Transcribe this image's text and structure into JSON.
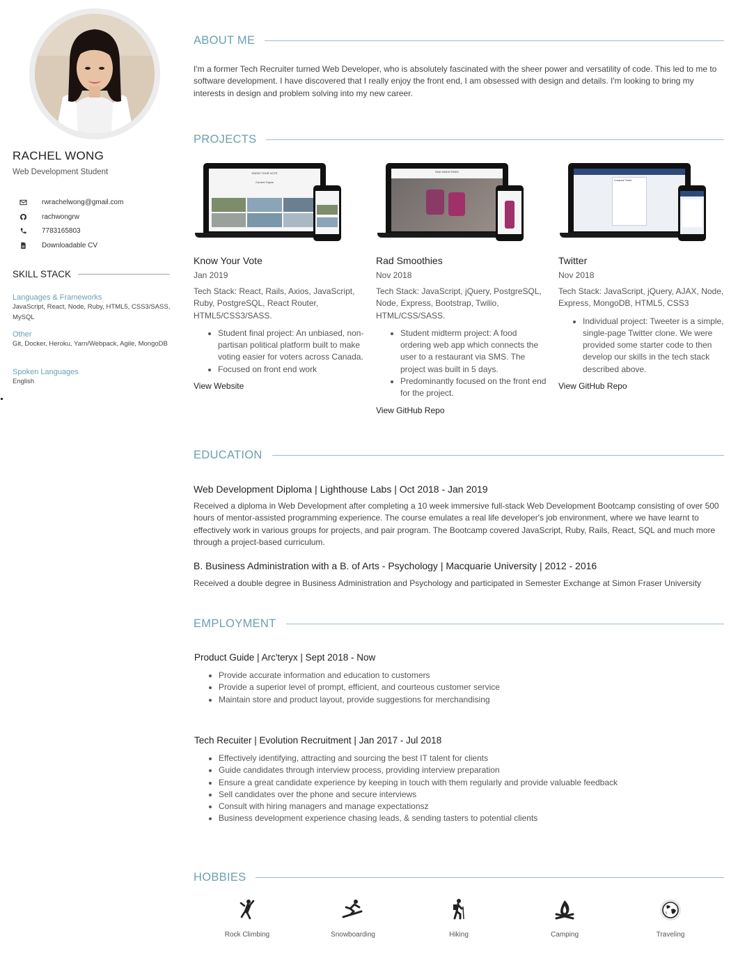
{
  "profile": {
    "name": "RACHEL WONG",
    "subtitle": "Web Development Student",
    "contacts": [
      {
        "icon": "envelope-icon",
        "text": "rwrachelwong@gmail.com"
      },
      {
        "icon": "github-icon",
        "text": "rachwongrw"
      },
      {
        "icon": "phone-icon",
        "text": "7783165803"
      },
      {
        "icon": "file-icon",
        "text": "Downloadable CV"
      }
    ]
  },
  "skills": {
    "heading": "SKILL STACK",
    "groups": [
      {
        "title": "Languages & Frameworks",
        "body": "JavaScript, React, Node, Ruby, HTML5, CSS3/SASS, MySQL"
      },
      {
        "title": "Other",
        "body": "Git, Docker, Heroku, Yarn/Webpack, Agile, MongoDB"
      },
      {
        "title": "Spoken Languages",
        "body": "English"
      }
    ]
  },
  "about": {
    "heading": "ABOUT ME",
    "text": "I'm a former Tech Recruiter turned Web Developer, who is absolutely fascinated with the sheer power and versatility of code. This led to me to software development. I have discovered that I really enjoy the front end, I am obsessed with design and details. I'm looking to bring my interests in design and problem solving into my new career."
  },
  "projects": {
    "heading": "PROJECTS",
    "items": [
      {
        "title": "Know Your Vote",
        "date": "Jan 2019",
        "stack": "Tech Stack: React, Rails, Axios, JavaScript, Ruby, PostgreSQL, React Router, HTML5/CSS3/SASS.",
        "bullets": [
          "Student final project: An unbiased, non-partisan political platform built to make voting easier for voters across Canada.",
          "Focused on front end work"
        ],
        "link": "View Website",
        "screen_text": "KNOW YOUR VOTE",
        "screen_sub": "Current Topics"
      },
      {
        "title": "Rad Smoothies",
        "date": "Nov 2018",
        "stack": "Tech Stack: JavaScript, jQuery, PostgreSQL, Node, Express, Bootstrap, Twilio, HTML/CSS/SASS.",
        "bullets": [
          "Student midterm project: A food ordering web app which connects the user to a restaurant via SMS. The project was built in 5 days.",
          "Predominantly focused on the front end for the project."
        ],
        "link": "View GitHub Repo",
        "screen_text": "RAD SMOOTHIES"
      },
      {
        "title": "Twitter",
        "date": "Nov 2018",
        "stack": "Tech Stack: JavaScript, jQuery, AJAX, Node, Express, MongoDB, HTML5, CSS3",
        "bullets": [
          "Individual project: Tweeter is a simple, single-page Twitter clone. We were provided some starter code to then develop our skills in the tech stack described above."
        ],
        "link": "View GitHub Repo",
        "screen_text": "Compose Tweet"
      }
    ]
  },
  "education": {
    "heading": "EDUCATION",
    "items": [
      {
        "title": "Web Development Diploma | Lighthouse Labs | Oct 2018 - Jan 2019",
        "text": "Received a diploma in Web Development after completing a 10 week immersive full-stack Web Development Bootcamp consisting of over 500 hours of mentor-assisted programming experience. The course emulates a real life developer's job environment, where we have learnt to effectively work in various groups for projects, and pair program. The Bootcamp covered JavaScript, Ruby, Rails, React, SQL and much more through a project-based curriculum."
      },
      {
        "title": "B. Business Administration with a B. of Arts - Psychology | Macquarie University | 2012 - 2016",
        "text": "Received a double degree in Business Administration and Psychology and participated in Semester Exchange at Simon Fraser University"
      }
    ]
  },
  "employment": {
    "heading": "EMPLOYMENT",
    "jobs": [
      {
        "title": "Product Guide | Arc'teryx | Sept 2018 - Now",
        "bullets": [
          "Provide accurate information and education to customers",
          "Provide a superior level of prompt, efficient, and courteous customer service",
          "Maintain store and product layout, provide suggestions for merchandising"
        ]
      },
      {
        "title": "Tech Recuiter | Evolution Recruitment | Jan 2017 - Jul 2018",
        "bullets": [
          "Effectively identifying, attracting and sourcing the best IT talent for clients",
          "Guide candidates through interview process, providing interview preparation",
          "Ensure a great candidate experience by keeping in touch with them regularly and provide valuable feedback",
          "Sell candidates over the phone and secure interviews",
          "Consult with hiring managers and manage expectationsz",
          "Business development experience chasing leads, & sending tasters to potential clients"
        ]
      }
    ]
  },
  "hobbies": {
    "heading": "HOBBIES",
    "items": [
      {
        "icon": "rock-climbing-icon",
        "label": "Rock Climbing"
      },
      {
        "icon": "snowboarding-icon",
        "label": "Snowboarding"
      },
      {
        "icon": "hiking-icon",
        "label": "Hiking"
      },
      {
        "icon": "camping-icon",
        "label": "Camping"
      },
      {
        "icon": "globe-icon",
        "label": "Traveling"
      }
    ]
  },
  "colors": {
    "accent": "#6a9fb1",
    "text": "#444444",
    "heading": "#222222"
  }
}
